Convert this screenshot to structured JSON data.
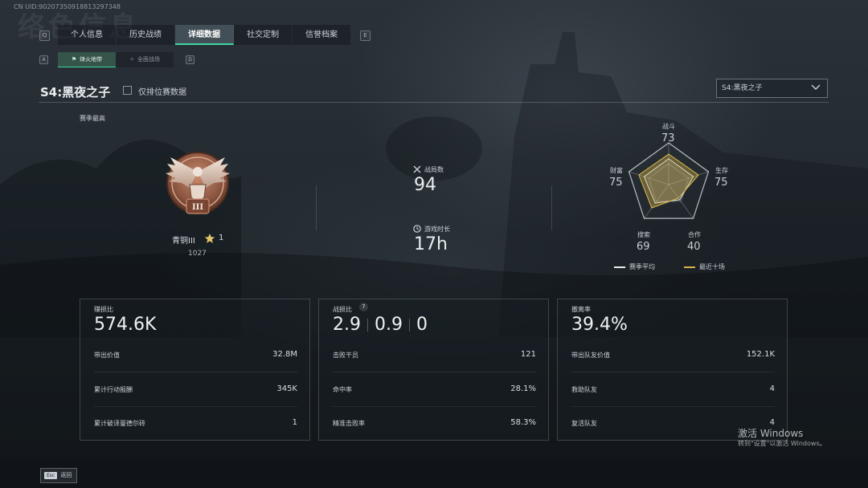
{
  "uid": "CN UID:9020735091881329734​8",
  "ghost_title": "络色信息",
  "tabs": [
    {
      "key": "Q",
      "label": "个人信息"
    },
    {
      "label": "历史战绩"
    },
    {
      "label": "详细数据",
      "active": true
    },
    {
      "label": "社交定制"
    },
    {
      "label": "信誉档案",
      "key_after": "E"
    }
  ],
  "subtabs": {
    "key_left": "A",
    "key_right": "D",
    "items": [
      {
        "label": "烽火地带",
        "active": true
      },
      {
        "label": "全面战场"
      }
    ]
  },
  "season": {
    "title": "S4:黑夜之子",
    "ranked_only_label": "仅排位赛数据",
    "ranked_only_checked": false,
    "selector_value": "S4:黑夜之子"
  },
  "peak": {
    "label": "赛季最高",
    "rank_name": "青铜III",
    "stars": "1",
    "score": "1027",
    "badge_numeral": "III"
  },
  "summary": {
    "matches_label": "战局数",
    "matches_value": "94",
    "playtime_label": "游戏时长",
    "playtime_value": "17h"
  },
  "radar": {
    "axes": [
      {
        "label": "战斗",
        "value": "73"
      },
      {
        "label": "生存",
        "value": "75"
      },
      {
        "label": "合作",
        "value": "40"
      },
      {
        "label": "搜索",
        "value": "69"
      },
      {
        "label": "财富",
        "value": "75"
      }
    ],
    "season_avg": [
      0.62,
      0.62,
      0.45,
      0.55,
      0.62
    ],
    "recent_ten": [
      0.73,
      0.75,
      0.4,
      0.69,
      0.75
    ],
    "legend": {
      "season_avg": "赛季平均",
      "recent_ten": "最近十场"
    },
    "colors": {
      "season_avg": "#e6ebee",
      "recent_ten": "#d4b44a"
    }
  },
  "cards": {
    "profit": {
      "label": "赚损比",
      "value": "574.6K",
      "rows": [
        {
          "k": "带出价值",
          "v": "32.8M"
        },
        {
          "k": "累计行动报酬",
          "v": "345K"
        },
        {
          "k": "累计破译曼德尔砖",
          "v": "1"
        }
      ]
    },
    "kd": {
      "label": "战损比",
      "values": [
        "2.9",
        "0.9",
        "0"
      ],
      "help": "?",
      "rows": [
        {
          "k": "击败干员",
          "v": "121"
        },
        {
          "k": "命中率",
          "v": "28.1%"
        },
        {
          "k": "精准击败率",
          "v": "58.3%"
        }
      ]
    },
    "extract": {
      "label": "撤离率",
      "value": "39.4%",
      "rows": [
        {
          "k": "带出队友价值",
          "v": "152.1K"
        },
        {
          "k": "救助队友",
          "v": "4"
        },
        {
          "k": "复活队友",
          "v": "4"
        }
      ]
    }
  },
  "watermark": {
    "line1": "激活 Windows",
    "line2": "转到\"设置\"以激活 Windows。"
  },
  "footer": {
    "esc_key": "Esc",
    "back_label": "返回"
  },
  "accent": "#3dd6a0"
}
